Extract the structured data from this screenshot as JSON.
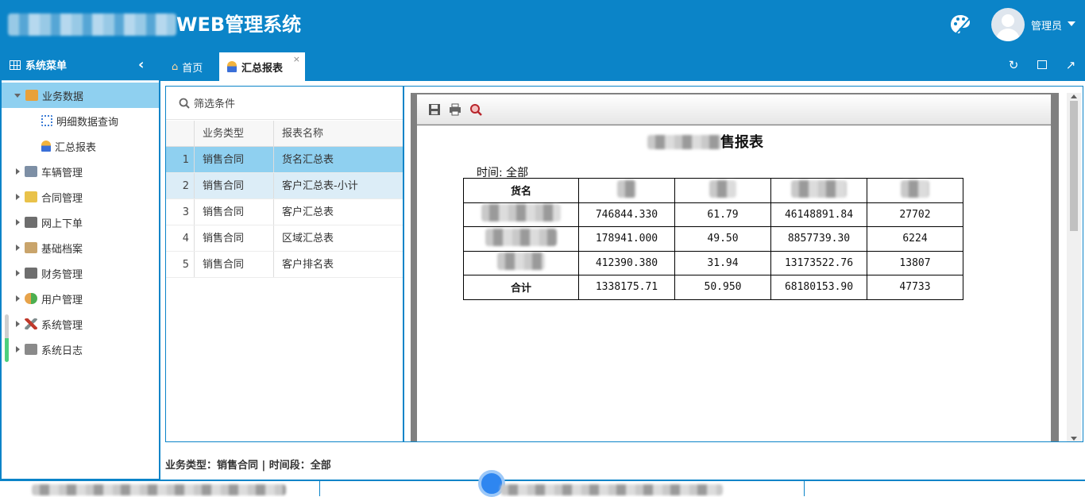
{
  "header": {
    "system_title": "WEB管理系统",
    "user_name": "管理员",
    "colors": {
      "primary": "#0b84c8",
      "selected_row": "#8fd0f0"
    }
  },
  "sidebar": {
    "title": "系统菜单",
    "collapse_icon": "chevron-left-icon",
    "items": [
      {
        "label": "业务数据",
        "icon": "truck-icon",
        "expanded": true
      },
      {
        "label": "明细数据查询",
        "icon": "document-icon"
      },
      {
        "label": "汇总报表",
        "icon": "worker-icon"
      },
      {
        "label": "车辆管理",
        "icon": "car-icon"
      },
      {
        "label": "合同管理",
        "icon": "contract-icon"
      },
      {
        "label": "网上下单",
        "icon": "folder-icon"
      },
      {
        "label": "基础档案",
        "icon": "notebook-icon"
      },
      {
        "label": "财务管理",
        "icon": "folder-icon"
      },
      {
        "label": "用户管理",
        "icon": "user-icon"
      },
      {
        "label": "系统管理",
        "icon": "tools-icon"
      },
      {
        "label": "系统日志",
        "icon": "log-icon"
      }
    ]
  },
  "tabs": [
    {
      "label": "首页",
      "icon": "home-icon"
    },
    {
      "label": "汇总报表",
      "icon": "worker-icon",
      "active": true
    }
  ],
  "toolbar_icons": [
    "refresh-icon",
    "maximize-icon",
    "open-external-icon"
  ],
  "report_list": {
    "filter_label": "筛选条件",
    "columns": [
      "业务类型",
      "报表名称"
    ],
    "rows": [
      {
        "num": "1",
        "type": "销售合同",
        "name": "货名汇总表"
      },
      {
        "num": "2",
        "type": "销售合同",
        "name": "客户汇总表-小计"
      },
      {
        "num": "3",
        "type": "销售合同",
        "name": "客户汇总表"
      },
      {
        "num": "4",
        "type": "销售合同",
        "name": "区域汇总表"
      },
      {
        "num": "5",
        "type": "销售合同",
        "name": "客户排名表"
      }
    ]
  },
  "viewer": {
    "toolbar": [
      "save-icon",
      "print-icon",
      "zoom-icon"
    ],
    "title_suffix": "售报表",
    "time_label": "时间: 全部",
    "table": {
      "first_col_header": "货名",
      "rows": [
        [
          "746844.330",
          "61.79",
          "46148891.84",
          "27702"
        ],
        [
          "178941.000",
          "49.50",
          "8857739.30",
          "6224"
        ],
        [
          "412390.380",
          "31.94",
          "13173522.76",
          "13807"
        ]
      ],
      "total_label": "合计",
      "total": [
        "1338175.71",
        "50.950",
        "68180153.90",
        "47733"
      ]
    }
  },
  "status": "业务类型：销售合同 | 时间段：全部"
}
